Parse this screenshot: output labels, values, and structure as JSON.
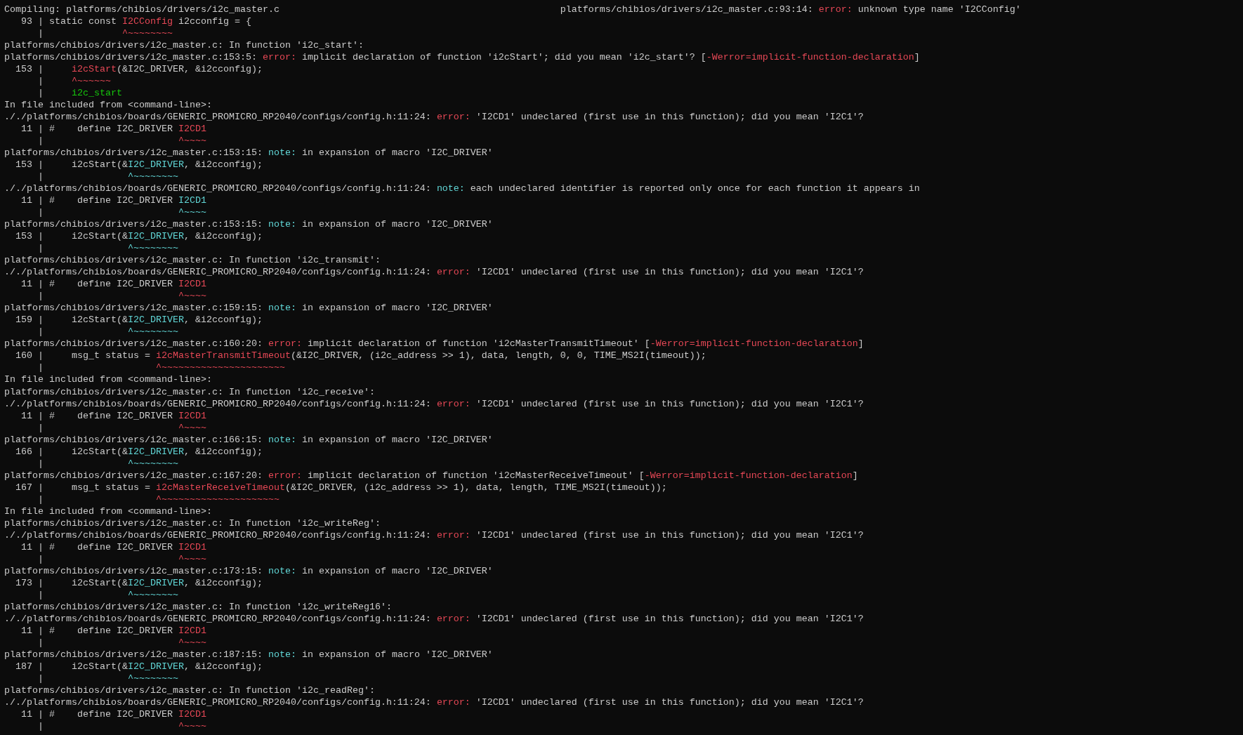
{
  "terminal": {
    "lines": [
      {
        "segments": [
          {
            "text": "Compiling: platforms/chibios/drivers/i2c_master.c",
            "kind": "plain"
          }
        ],
        "right": [
          {
            "text": "platforms/chibios/drivers/i2c_master.c:93:14: ",
            "kind": "plain"
          },
          {
            "text": "error:",
            "kind": "error"
          },
          {
            "text": " unknown type name 'I2CConfig'",
            "kind": "plain"
          }
        ]
      },
      {
        "segments": [
          {
            "text": "   93 | static const ",
            "kind": "plain"
          },
          {
            "text": "I2CConfig",
            "kind": "error"
          },
          {
            "text": " i2cconfig = {",
            "kind": "plain"
          }
        ]
      },
      {
        "segments": [
          {
            "text": "      |              ",
            "kind": "plain"
          },
          {
            "text": "^~~~~~~~~",
            "kind": "error"
          }
        ]
      },
      {
        "segments": [
          {
            "text": "platforms/chibios/drivers/i2c_master.c: In function 'i2c_start':",
            "kind": "plain"
          }
        ]
      },
      {
        "segments": [
          {
            "text": "platforms/chibios/drivers/i2c_master.c:153:5: ",
            "kind": "plain"
          },
          {
            "text": "error:",
            "kind": "error"
          },
          {
            "text": " implicit declaration of function 'i2cStart'; did you mean 'i2c_start'? [",
            "kind": "plain"
          },
          {
            "text": "-Werror=implicit-function-declaration",
            "kind": "error"
          },
          {
            "text": "]",
            "kind": "plain"
          }
        ]
      },
      {
        "segments": [
          {
            "text": "  153 |     ",
            "kind": "plain"
          },
          {
            "text": "i2cStart",
            "kind": "error"
          },
          {
            "text": "(&I2C_DRIVER, &i2cconfig);",
            "kind": "plain"
          }
        ]
      },
      {
        "segments": [
          {
            "text": "      |     ",
            "kind": "plain"
          },
          {
            "text": "^~~~~~~",
            "kind": "error"
          }
        ]
      },
      {
        "segments": [
          {
            "text": "      |     ",
            "kind": "plain"
          },
          {
            "text": "i2c_start",
            "kind": "fixit"
          }
        ]
      },
      {
        "segments": [
          {
            "text": "In file included from <command-line>:",
            "kind": "plain"
          }
        ]
      },
      {
        "segments": [
          {
            "text": "././platforms/chibios/boards/GENERIC_PROMICRO_RP2040/configs/config.h:11:24: ",
            "kind": "plain"
          },
          {
            "text": "error:",
            "kind": "error"
          },
          {
            "text": " 'I2CD1' undeclared (first use in this function); did you mean 'I2C1'?",
            "kind": "plain"
          }
        ]
      },
      {
        "segments": [
          {
            "text": "   11 | #    define I2C_DRIVER ",
            "kind": "plain"
          },
          {
            "text": "I2CD1",
            "kind": "error"
          }
        ]
      },
      {
        "segments": [
          {
            "text": "      |                        ",
            "kind": "plain"
          },
          {
            "text": "^~~~~",
            "kind": "error"
          }
        ]
      },
      {
        "segments": [
          {
            "text": "platforms/chibios/drivers/i2c_master.c:153:15: ",
            "kind": "plain"
          },
          {
            "text": "note:",
            "kind": "note"
          },
          {
            "text": " in expansion of macro 'I2C_DRIVER'",
            "kind": "plain"
          }
        ]
      },
      {
        "segments": [
          {
            "text": "  153 |     i2cStart(&",
            "kind": "plain"
          },
          {
            "text": "I2C_DRIVER",
            "kind": "note"
          },
          {
            "text": ", &i2cconfig);",
            "kind": "plain"
          }
        ]
      },
      {
        "segments": [
          {
            "text": "      |               ",
            "kind": "plain"
          },
          {
            "text": "^~~~~~~~~",
            "kind": "note"
          }
        ]
      },
      {
        "segments": [
          {
            "text": "././platforms/chibios/boards/GENERIC_PROMICRO_RP2040/configs/config.h:11:24: ",
            "kind": "plain"
          },
          {
            "text": "note:",
            "kind": "note"
          },
          {
            "text": " each undeclared identifier is reported only once for each function it appears in",
            "kind": "plain"
          }
        ]
      },
      {
        "segments": [
          {
            "text": "   11 | #    define I2C_DRIVER ",
            "kind": "plain"
          },
          {
            "text": "I2CD1",
            "kind": "note"
          }
        ]
      },
      {
        "segments": [
          {
            "text": "      |                        ",
            "kind": "plain"
          },
          {
            "text": "^~~~~",
            "kind": "note"
          }
        ]
      },
      {
        "segments": [
          {
            "text": "platforms/chibios/drivers/i2c_master.c:153:15: ",
            "kind": "plain"
          },
          {
            "text": "note:",
            "kind": "note"
          },
          {
            "text": " in expansion of macro 'I2C_DRIVER'",
            "kind": "plain"
          }
        ]
      },
      {
        "segments": [
          {
            "text": "  153 |     i2cStart(&",
            "kind": "plain"
          },
          {
            "text": "I2C_DRIVER",
            "kind": "note"
          },
          {
            "text": ", &i2cconfig);",
            "kind": "plain"
          }
        ]
      },
      {
        "segments": [
          {
            "text": "      |               ",
            "kind": "plain"
          },
          {
            "text": "^~~~~~~~~",
            "kind": "note"
          }
        ]
      },
      {
        "segments": [
          {
            "text": "platforms/chibios/drivers/i2c_master.c: In function 'i2c_transmit':",
            "kind": "plain"
          }
        ]
      },
      {
        "segments": [
          {
            "text": "././platforms/chibios/boards/GENERIC_PROMICRO_RP2040/configs/config.h:11:24: ",
            "kind": "plain"
          },
          {
            "text": "error:",
            "kind": "error"
          },
          {
            "text": " 'I2CD1' undeclared (first use in this function); did you mean 'I2C1'?",
            "kind": "plain"
          }
        ]
      },
      {
        "segments": [
          {
            "text": "   11 | #    define I2C_DRIVER ",
            "kind": "plain"
          },
          {
            "text": "I2CD1",
            "kind": "error"
          }
        ]
      },
      {
        "segments": [
          {
            "text": "      |                        ",
            "kind": "plain"
          },
          {
            "text": "^~~~~",
            "kind": "error"
          }
        ]
      },
      {
        "segments": [
          {
            "text": "platforms/chibios/drivers/i2c_master.c:159:15: ",
            "kind": "plain"
          },
          {
            "text": "note:",
            "kind": "note"
          },
          {
            "text": " in expansion of macro 'I2C_DRIVER'",
            "kind": "plain"
          }
        ]
      },
      {
        "segments": [
          {
            "text": "  159 |     i2cStart(&",
            "kind": "plain"
          },
          {
            "text": "I2C_DRIVER",
            "kind": "note"
          },
          {
            "text": ", &i2cconfig);",
            "kind": "plain"
          }
        ]
      },
      {
        "segments": [
          {
            "text": "      |               ",
            "kind": "plain"
          },
          {
            "text": "^~~~~~~~~",
            "kind": "note"
          }
        ]
      },
      {
        "segments": [
          {
            "text": "platforms/chibios/drivers/i2c_master.c:160:20: ",
            "kind": "plain"
          },
          {
            "text": "error:",
            "kind": "error"
          },
          {
            "text": " implicit declaration of function 'i2cMasterTransmitTimeout' [",
            "kind": "plain"
          },
          {
            "text": "-Werror=implicit-function-declaration",
            "kind": "error"
          },
          {
            "text": "]",
            "kind": "plain"
          }
        ]
      },
      {
        "segments": [
          {
            "text": "  160 |     msg_t status = ",
            "kind": "plain"
          },
          {
            "text": "i2cMasterTransmitTimeout",
            "kind": "error"
          },
          {
            "text": "(&I2C_DRIVER, (i2c_address >> 1), data, length, 0, 0, TIME_MS2I(timeout));",
            "kind": "plain"
          }
        ]
      },
      {
        "segments": [
          {
            "text": "      |                    ",
            "kind": "plain"
          },
          {
            "text": "^~~~~~~~~~~~~~~~~~~~~~~",
            "kind": "error"
          }
        ]
      },
      {
        "segments": [
          {
            "text": "In file included from <command-line>:",
            "kind": "plain"
          }
        ]
      },
      {
        "segments": [
          {
            "text": "platforms/chibios/drivers/i2c_master.c: In function 'i2c_receive':",
            "kind": "plain"
          }
        ]
      },
      {
        "segments": [
          {
            "text": "././platforms/chibios/boards/GENERIC_PROMICRO_RP2040/configs/config.h:11:24: ",
            "kind": "plain"
          },
          {
            "text": "error:",
            "kind": "error"
          },
          {
            "text": " 'I2CD1' undeclared (first use in this function); did you mean 'I2C1'?",
            "kind": "plain"
          }
        ]
      },
      {
        "segments": [
          {
            "text": "   11 | #    define I2C_DRIVER ",
            "kind": "plain"
          },
          {
            "text": "I2CD1",
            "kind": "error"
          }
        ]
      },
      {
        "segments": [
          {
            "text": "      |                        ",
            "kind": "plain"
          },
          {
            "text": "^~~~~",
            "kind": "error"
          }
        ]
      },
      {
        "segments": [
          {
            "text": "platforms/chibios/drivers/i2c_master.c:166:15: ",
            "kind": "plain"
          },
          {
            "text": "note:",
            "kind": "note"
          },
          {
            "text": " in expansion of macro 'I2C_DRIVER'",
            "kind": "plain"
          }
        ]
      },
      {
        "segments": [
          {
            "text": "  166 |     i2cStart(&",
            "kind": "plain"
          },
          {
            "text": "I2C_DRIVER",
            "kind": "note"
          },
          {
            "text": ", &i2cconfig);",
            "kind": "plain"
          }
        ]
      },
      {
        "segments": [
          {
            "text": "      |               ",
            "kind": "plain"
          },
          {
            "text": "^~~~~~~~~",
            "kind": "note"
          }
        ]
      },
      {
        "segments": [
          {
            "text": "platforms/chibios/drivers/i2c_master.c:167:20: ",
            "kind": "plain"
          },
          {
            "text": "error:",
            "kind": "error"
          },
          {
            "text": " implicit declaration of function 'i2cMasterReceiveTimeout' [",
            "kind": "plain"
          },
          {
            "text": "-Werror=implicit-function-declaration",
            "kind": "error"
          },
          {
            "text": "]",
            "kind": "plain"
          }
        ]
      },
      {
        "segments": [
          {
            "text": "  167 |     msg_t status = ",
            "kind": "plain"
          },
          {
            "text": "i2cMasterReceiveTimeout",
            "kind": "error"
          },
          {
            "text": "(&I2C_DRIVER, (i2c_address >> 1), data, length, TIME_MS2I(timeout));",
            "kind": "plain"
          }
        ]
      },
      {
        "segments": [
          {
            "text": "      |                    ",
            "kind": "plain"
          },
          {
            "text": "^~~~~~~~~~~~~~~~~~~~~~",
            "kind": "error"
          }
        ]
      },
      {
        "segments": [
          {
            "text": "In file included from <command-line>:",
            "kind": "plain"
          }
        ]
      },
      {
        "segments": [
          {
            "text": "platforms/chibios/drivers/i2c_master.c: In function 'i2c_writeReg':",
            "kind": "plain"
          }
        ]
      },
      {
        "segments": [
          {
            "text": "././platforms/chibios/boards/GENERIC_PROMICRO_RP2040/configs/config.h:11:24: ",
            "kind": "plain"
          },
          {
            "text": "error:",
            "kind": "error"
          },
          {
            "text": " 'I2CD1' undeclared (first use in this function); did you mean 'I2C1'?",
            "kind": "plain"
          }
        ]
      },
      {
        "segments": [
          {
            "text": "   11 | #    define I2C_DRIVER ",
            "kind": "plain"
          },
          {
            "text": "I2CD1",
            "kind": "error"
          }
        ]
      },
      {
        "segments": [
          {
            "text": "      |                        ",
            "kind": "plain"
          },
          {
            "text": "^~~~~",
            "kind": "error"
          }
        ]
      },
      {
        "segments": [
          {
            "text": "platforms/chibios/drivers/i2c_master.c:173:15: ",
            "kind": "plain"
          },
          {
            "text": "note:",
            "kind": "note"
          },
          {
            "text": " in expansion of macro 'I2C_DRIVER'",
            "kind": "plain"
          }
        ]
      },
      {
        "segments": [
          {
            "text": "  173 |     i2cStart(&",
            "kind": "plain"
          },
          {
            "text": "I2C_DRIVER",
            "kind": "note"
          },
          {
            "text": ", &i2cconfig);",
            "kind": "plain"
          }
        ]
      },
      {
        "segments": [
          {
            "text": "      |               ",
            "kind": "plain"
          },
          {
            "text": "^~~~~~~~~",
            "kind": "note"
          }
        ]
      },
      {
        "segments": [
          {
            "text": "platforms/chibios/drivers/i2c_master.c: In function 'i2c_writeReg16':",
            "kind": "plain"
          }
        ]
      },
      {
        "segments": [
          {
            "text": "././platforms/chibios/boards/GENERIC_PROMICRO_RP2040/configs/config.h:11:24: ",
            "kind": "plain"
          },
          {
            "text": "error:",
            "kind": "error"
          },
          {
            "text": " 'I2CD1' undeclared (first use in this function); did you mean 'I2C1'?",
            "kind": "plain"
          }
        ]
      },
      {
        "segments": [
          {
            "text": "   11 | #    define I2C_DRIVER ",
            "kind": "plain"
          },
          {
            "text": "I2CD1",
            "kind": "error"
          }
        ]
      },
      {
        "segments": [
          {
            "text": "      |                        ",
            "kind": "plain"
          },
          {
            "text": "^~~~~",
            "kind": "error"
          }
        ]
      },
      {
        "segments": [
          {
            "text": "platforms/chibios/drivers/i2c_master.c:187:15: ",
            "kind": "plain"
          },
          {
            "text": "note:",
            "kind": "note"
          },
          {
            "text": " in expansion of macro 'I2C_DRIVER'",
            "kind": "plain"
          }
        ]
      },
      {
        "segments": [
          {
            "text": "  187 |     i2cStart(&",
            "kind": "plain"
          },
          {
            "text": "I2C_DRIVER",
            "kind": "note"
          },
          {
            "text": ", &i2cconfig);",
            "kind": "plain"
          }
        ]
      },
      {
        "segments": [
          {
            "text": "      |               ",
            "kind": "plain"
          },
          {
            "text": "^~~~~~~~~",
            "kind": "note"
          }
        ]
      },
      {
        "segments": [
          {
            "text": "platforms/chibios/drivers/i2c_master.c: In function 'i2c_readReg':",
            "kind": "plain"
          }
        ]
      },
      {
        "segments": [
          {
            "text": "././platforms/chibios/boards/GENERIC_PROMICRO_RP2040/configs/config.h:11:24: ",
            "kind": "plain"
          },
          {
            "text": "error:",
            "kind": "error"
          },
          {
            "text": " 'I2CD1' undeclared (first use in this function); did you mean 'I2C1'?",
            "kind": "plain"
          }
        ]
      },
      {
        "segments": [
          {
            "text": "   11 | #    define I2C_DRIVER ",
            "kind": "plain"
          },
          {
            "text": "I2CD1",
            "kind": "error"
          }
        ]
      },
      {
        "segments": [
          {
            "text": "      |                        ",
            "kind": "plain"
          },
          {
            "text": "^~~~~",
            "kind": "error"
          }
        ]
      }
    ]
  }
}
